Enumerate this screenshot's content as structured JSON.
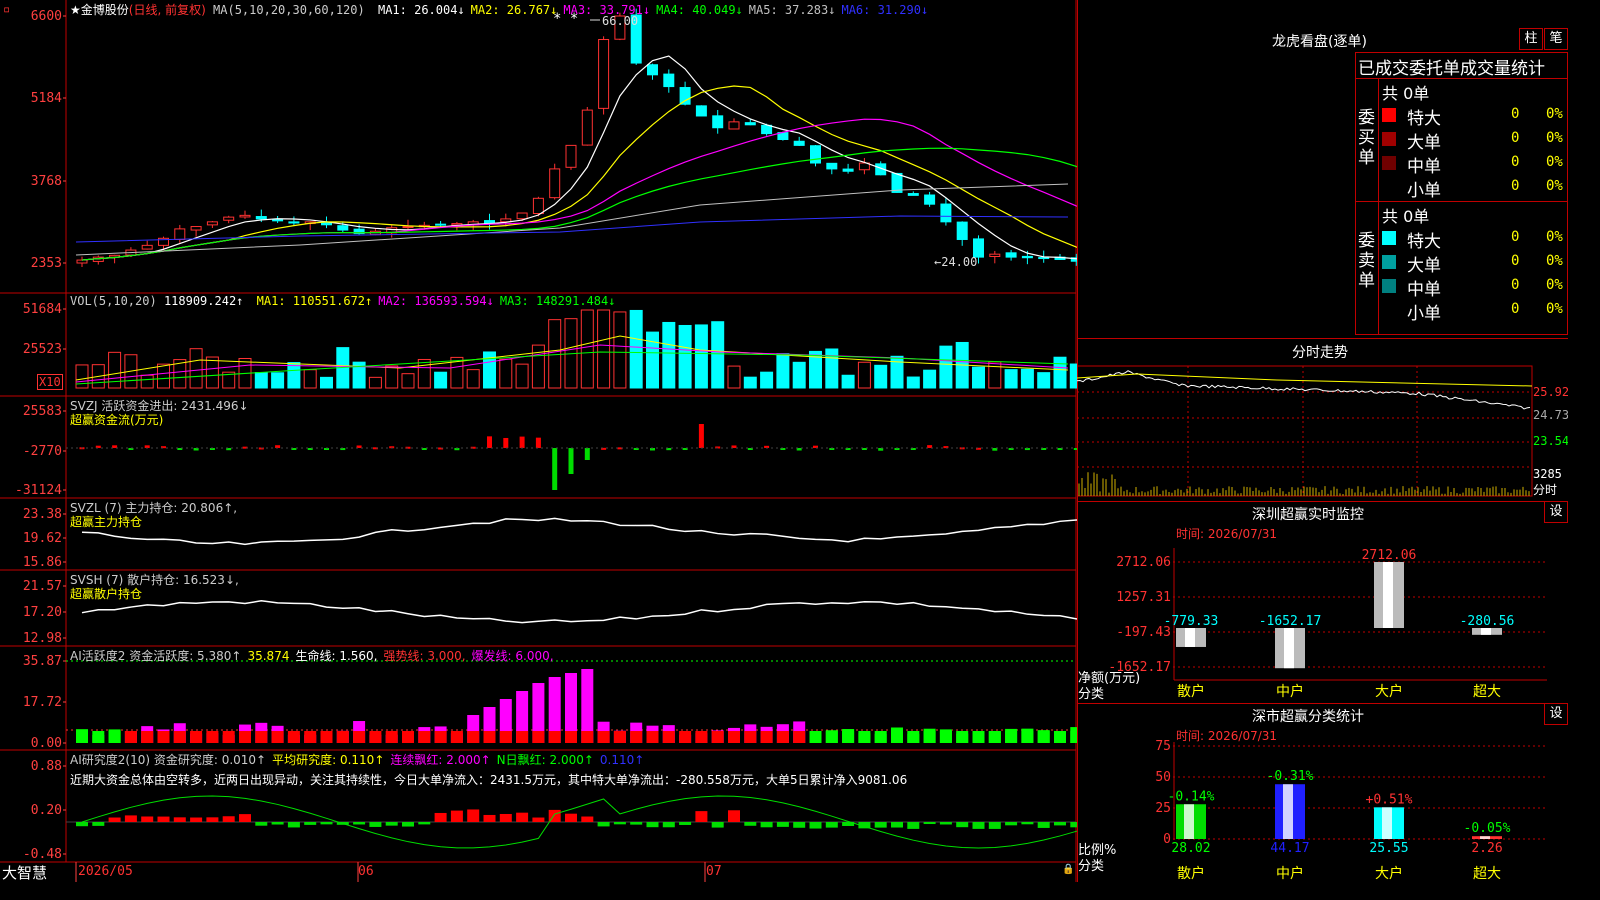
{
  "colors": {
    "up": "#ff3232",
    "down": "#00ffff",
    "ma1": "#ffffff",
    "ma2": "#ffff00",
    "ma3": "#ff00ff",
    "ma4": "#00ff00",
    "ma5": "#c0c0c0",
    "ma6": "#3030ff",
    "grid": "#c00000",
    "axis": "#ff4040"
  },
  "price_panel": {
    "stock_name": "金博股份",
    "period": "(日线, 前复权)",
    "ma_def": "MA(5,10,20,30,60,120)",
    "ma_values": [
      {
        "label": "MA1: 26.004↓",
        "color": "#ffffff"
      },
      {
        "label": "MA2: 26.767↓",
        "color": "#ffff00"
      },
      {
        "label": "MA3: 33.791↓",
        "color": "#ff00ff"
      },
      {
        "label": "MA4: 40.049↓",
        "color": "#00ff00"
      },
      {
        "label": "MA5: 37.283↓",
        "color": "#c0c0c0"
      },
      {
        "label": "MA6: 31.290↓",
        "color": "#3030ff"
      }
    ],
    "y_ticks": [
      "6600",
      "5184",
      "3768",
      "2353"
    ],
    "high_label": "66.00",
    "low_label": "←24.00",
    "star_marks": "* *"
  },
  "vol_panel": {
    "header": "VOL(5,10,20)",
    "value": "118909.242↑",
    "mas": [
      {
        "label": "MA1: 110551.672↑",
        "color": "#ffff00"
      },
      {
        "label": "MA2: 136593.594↓",
        "color": "#ff00ff"
      },
      {
        "label": "MA3: 148291.484↓",
        "color": "#00ff00"
      }
    ],
    "y_ticks": [
      "51684",
      "25523"
    ],
    "unit": "X10"
  },
  "svzj_panel": {
    "header": "SVZJ  活跃资金进出: 2431.496↓",
    "sub": "超赢资金流(万元)",
    "y_ticks": [
      "25583",
      "-2770",
      "-31124"
    ]
  },
  "svzl_panel": {
    "header": "SVZL (7) 主力持仓: 20.806↑,",
    "sub": "超赢主力持仓",
    "y_ticks": [
      "23.38",
      "19.62",
      "15.86"
    ]
  },
  "svsh_panel": {
    "header": "SVSH (7) 散户持仓: 16.523↓,",
    "sub": "超赢散户持仓",
    "y_ticks": [
      "21.57",
      "17.20",
      "12.98"
    ]
  },
  "ai_panel": {
    "header": "AI活跃度2 资金活跃度: 5.380↑",
    "extra": [
      {
        "label": "35.874",
        "color": "#ffff00"
      },
      {
        "label": "生命线: 1.560,",
        "color": "#ffffff"
      },
      {
        "label": "强势线: 3.000,",
        "color": "#ff3232"
      },
      {
        "label": "爆发线: 6.000,",
        "color": "#ff00ff"
      }
    ],
    "y_ticks": [
      "35.87",
      "17.72",
      "0.00"
    ]
  },
  "ai2_panel": {
    "header": "AI研究度2(10) 资金研究度: 0.010↑",
    "extra": [
      {
        "label": "平均研究度: 0.110↑",
        "color": "#ffff00"
      },
      {
        "label": "连续飘红: 2.000↑",
        "color": "#ff00ff"
      },
      {
        "label": "N日飘红: 2.000↑",
        "color": "#00ff00"
      },
      {
        "label": "0.110↑",
        "color": "#3030ff"
      }
    ],
    "summary": "近期大资金总体由空转多，近两日出现异动，关注其持续性，今日大单净流入：2431.5万元，其中特大单净流出：-280.558万元，大单5日累计净入9081.06",
    "y_ticks": [
      "0.88",
      "0.20",
      "-0.48"
    ]
  },
  "x_axis": {
    "brand": "大智慧",
    "labels": [
      "2026/05",
      "06",
      "07"
    ]
  },
  "right": {
    "lhb_title": "龙虎看盘(逐单)",
    "btn1": "柱",
    "btn2": "笔",
    "table_title": "已成交委托单成交量统计",
    "buy": {
      "side": "委买单",
      "total": "共 0单",
      "rows": [
        {
          "name": "特大",
          "val": "0",
          "pct": "0%",
          "color": "#ff0000"
        },
        {
          "name": "大单",
          "val": "0",
          "pct": "0%",
          "color": "#a00000"
        },
        {
          "name": "中单",
          "val": "0",
          "pct": "0%",
          "color": "#700000"
        },
        {
          "name": "小单",
          "val": "0",
          "pct": "0%",
          "color": "#000000"
        }
      ]
    },
    "sell": {
      "side": "委卖单",
      "total": "共 0单",
      "rows": [
        {
          "name": "特大",
          "val": "0",
          "pct": "0%",
          "color": "#00ffff"
        },
        {
          "name": "大单",
          "val": "0",
          "pct": "0%",
          "color": "#00a0a0"
        },
        {
          "name": "中单",
          "val": "0",
          "pct": "0%",
          "color": "#008080"
        },
        {
          "name": "小单",
          "val": "0",
          "pct": "0%",
          "color": "#000000"
        }
      ]
    },
    "intraday": {
      "title": "分时走势",
      "y_ticks": [
        "25.92",
        "24.73",
        "23.54"
      ],
      "vol_tick": "3285",
      "vol_label": "分时"
    },
    "sz_monitor": {
      "title": "深圳超赢实时监控",
      "set": "设",
      "time": "时间: 2026/07/31",
      "y_ticks": [
        "2712.06",
        "1257.31",
        "-197.43",
        "-1652.17"
      ],
      "y_unit": "净额(万元)",
      "x_unit": "分类",
      "cats": [
        "散户",
        "中户",
        "大户",
        "超大"
      ],
      "values": [
        "-779.33",
        "-1652.17",
        "2712.06",
        "-280.56"
      ],
      "nums": [
        -779.33,
        -1652.17,
        2712.06,
        -280.56
      ]
    },
    "sz_stats": {
      "title": "深市超赢分类统计",
      "set": "设",
      "time": "时间: 2026/07/31",
      "y_ticks": [
        "75",
        "50",
        "25",
        "0"
      ],
      "y_unit": "比例%",
      "x_unit": "分类",
      "cats": [
        "散户",
        "中户",
        "大户",
        "超大"
      ],
      "values": [
        "28.02",
        "44.17",
        "25.55",
        "2.26"
      ],
      "nums": [
        28.02,
        44.17,
        25.55,
        2.26
      ],
      "changes": [
        {
          "label": "-0.14%",
          "color": "#00ff00"
        },
        {
          "label": "-0.31%",
          "color": "#00ff00"
        },
        {
          "label": "+0.51%",
          "color": "#ff3232"
        },
        {
          "label": "-0.05%",
          "color": "#00ff00"
        }
      ]
    }
  }
}
